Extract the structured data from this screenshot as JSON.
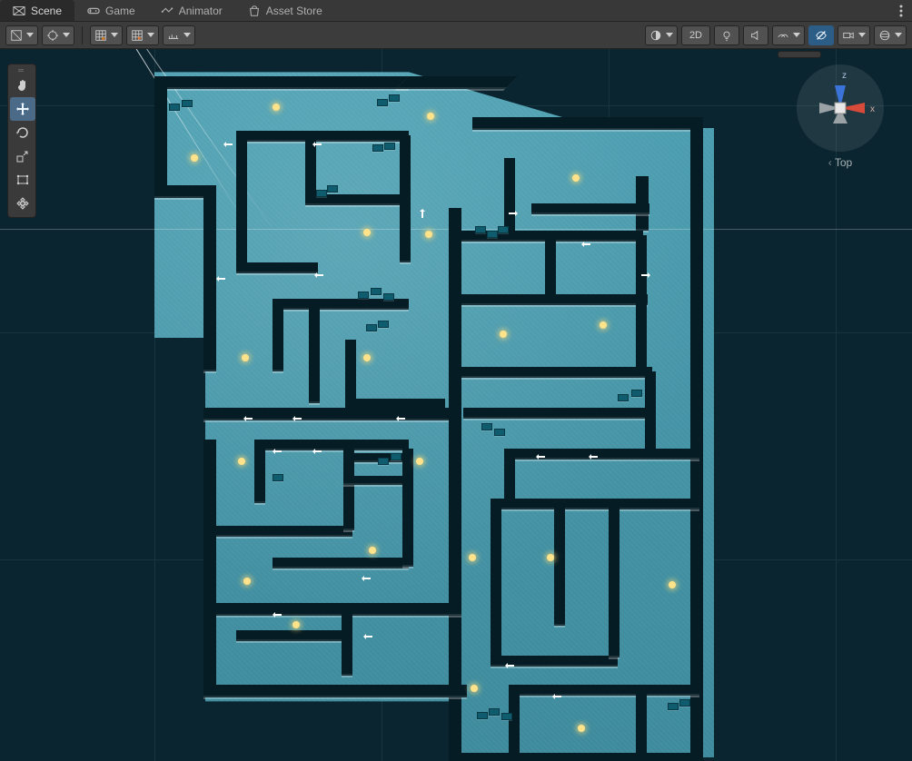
{
  "tabs": {
    "scene": "Scene",
    "game": "Game",
    "animator": "Animator",
    "asset_store": "Asset Store"
  },
  "toolbar": {
    "mode_2d": "2D"
  },
  "gizmo": {
    "x": "x",
    "z": "z",
    "view_label": "Top"
  }
}
